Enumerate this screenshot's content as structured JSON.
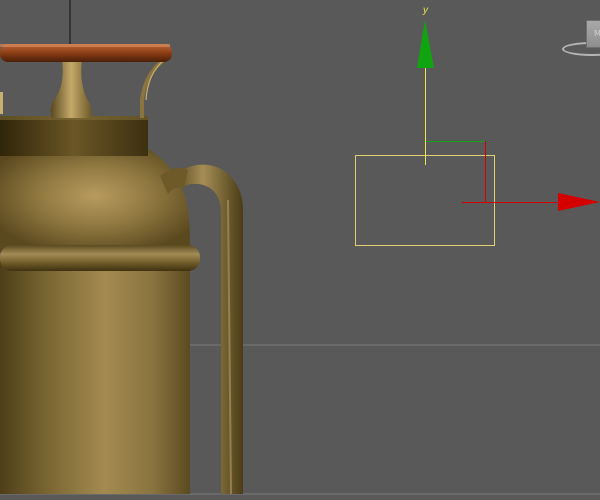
{
  "viewport": {
    "background_color": "#595959",
    "grid_line_color": "#7a7a7a"
  },
  "gizmo": {
    "axis_y_label": "y",
    "axis_y_color": "#11a411",
    "axis_y_line_color": "#e8e84c",
    "axis_x_color": "#d40000",
    "selection_box_color": "#e0d070"
  },
  "viewcube": {
    "label": "M",
    "icon": "viewcube-icon"
  },
  "model": {
    "body_color": "#8a7440",
    "lid_color": "#8a3d14"
  }
}
